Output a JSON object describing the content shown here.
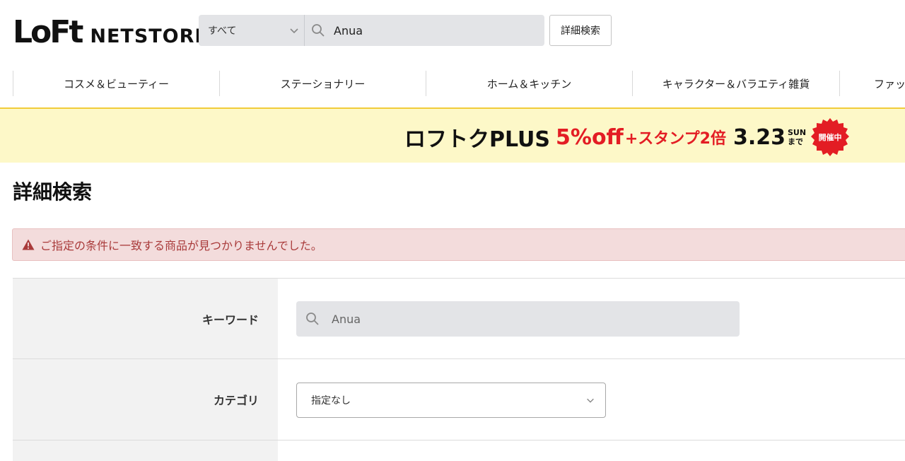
{
  "header": {
    "logo_mark": "LoFt",
    "logo_text": "NETSTORE",
    "search_scope": "すべて",
    "search_value": "Anua",
    "advanced_button": "詳細検索"
  },
  "nav": {
    "items": [
      {
        "label": "コスメ＆ビューティー"
      },
      {
        "label": "ステーショナリー"
      },
      {
        "label": "ホーム＆キッチン"
      },
      {
        "label": "キャラクター＆バラエティ雑貨"
      },
      {
        "label": "ファッ"
      }
    ]
  },
  "banner": {
    "part1": "ロフトクPLUS",
    "part2": "5%off",
    "part3": "+スタンプ2倍",
    "date": "3.23",
    "date_day": "SUN",
    "date_suffix": "まで",
    "badge": "開催中",
    "colors": {
      "bg": "#fdf8c8",
      "accent": "#e31d24"
    }
  },
  "page": {
    "title": "詳細検索",
    "alert": "ご指定の条件に一致する商品が見つかりませんでした。"
  },
  "form": {
    "keyword_label": "キーワード",
    "keyword_value": "Anua",
    "category_label": "カテゴリ",
    "category_value": "指定なし"
  }
}
